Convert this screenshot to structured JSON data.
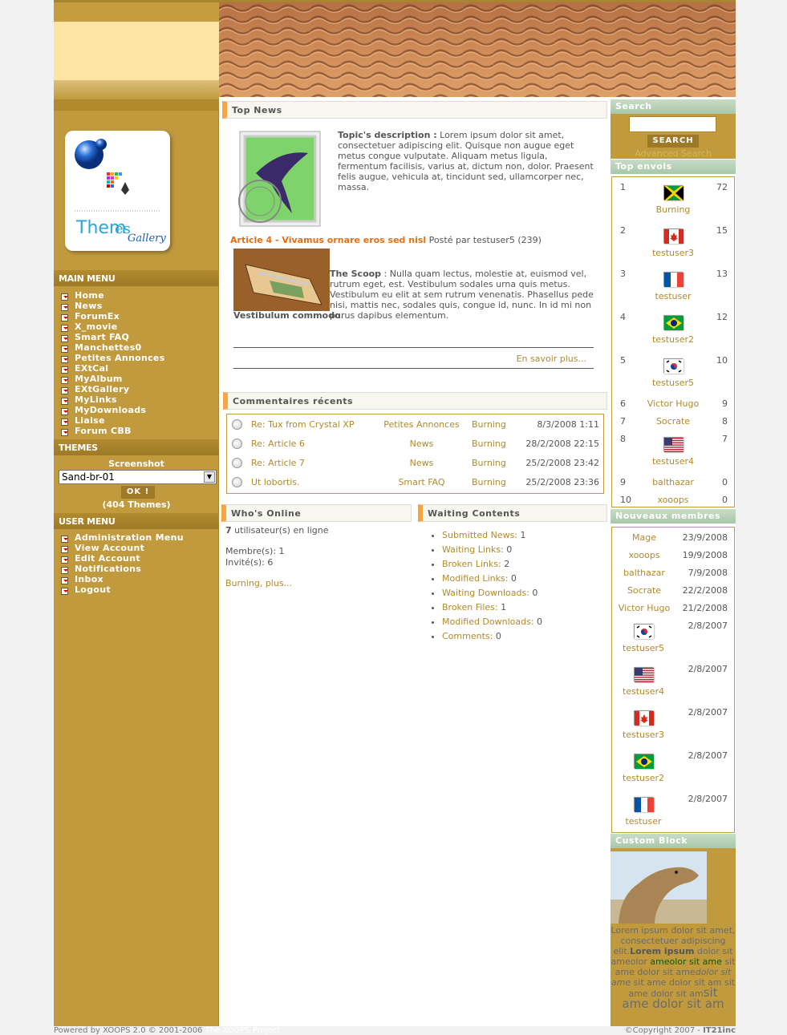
{
  "main_menu": {
    "title": "Main Menu",
    "items": [
      "Home",
      "News",
      "ForumEx",
      "X_movie",
      "Smart FAQ",
      "Manchettes0",
      "Petites Annonces",
      "EXtCal",
      "MyAlbum",
      "EXtGallery",
      "MyLinks",
      "MyDownloads",
      "Liaise",
      "Forum CBB"
    ]
  },
  "themes": {
    "title": "Themes",
    "screenshot_label": "Screenshot",
    "selected": "Sand-br-01",
    "ok_label": "OK !",
    "count": "(404 Themes)"
  },
  "user_menu": {
    "title": "User Menu",
    "items": [
      "Administration Menu",
      "View Account",
      "Edit Account",
      "Notifications",
      "Inbox",
      "Logout"
    ]
  },
  "logo_text": "Themes Gallery",
  "top_news": {
    "title": "Top News",
    "desc_label": "Topic's description :",
    "desc_text": " Lorem ipsum dolor sit amet, consectetuer adipiscing elit. Quisque non augue eget metus congue vulputate. Aliquam metus ligula, fermentum facilisis, varius at, dictum non, dolor. Praesent felis augue, vehicula at, tincidunt sed, ullamcorper nec, massa.",
    "article_title": "Article 4 - Vivamus ornare eros sed nisl",
    "posted_by": " Posté par testuser5 (239)",
    "scoop_label": "The Scoop",
    "scoop_text": " : Nulla quam lectus, molestie at, euismod vel, rutrum eget, est. Vestibulum sodales urna quis metus. Vestibulum eu elit at sem rutrum venenatis. Phasellus pede nisi, mattis nec, sodales quis, congue id, nunc. In id mi non purus dapibus elementum. ",
    "scoop_bold": "Vestibulum commodo",
    "scoop_end": ".",
    "more": "En savoir plus..."
  },
  "comments": {
    "title": "Commentaires récents",
    "rows": [
      {
        "subject": "Re: Tux from Crystal XP",
        "module": "Petites Annonces",
        "user": "Burning",
        "date": "8/3/2008 1:11"
      },
      {
        "subject": "Re: Article 6",
        "module": "News",
        "user": "Burning",
        "date": "28/2/2008 22:15"
      },
      {
        "subject": "Re: Article 7",
        "module": "News",
        "user": "Burning",
        "date": "25/2/2008 23:42"
      },
      {
        "subject": "Ut lobortis.",
        "module": "Smart FAQ",
        "user": "Burning",
        "date": "25/2/2008 23:36"
      }
    ]
  },
  "whos_online": {
    "title": "Who's Online",
    "count": "7",
    "count_text": " utilisateur(s) en ligne",
    "members": "Membre(s): 1",
    "guests": "Invité(s): 6",
    "link": "Burning, plus..."
  },
  "waiting": {
    "title": "Waiting Contents",
    "items": [
      {
        "label": "Submitted News:",
        "value": " 1"
      },
      {
        "label": "Waiting Links:",
        "value": " 0"
      },
      {
        "label": "Broken Links:",
        "value": " 2"
      },
      {
        "label": "Modified Links:",
        "value": " 0"
      },
      {
        "label": "Waiting Downloads:",
        "value": " 0"
      },
      {
        "label": "Broken Files:",
        "value": " 1"
      },
      {
        "label": "Modified Downloads:",
        "value": " 0"
      },
      {
        "label": "Comments:",
        "value": " 0"
      }
    ]
  },
  "search": {
    "title": "Search",
    "button": "SEARCH",
    "advanced": "Advanced Search",
    "value": ""
  },
  "top_envois": {
    "title": "Top envois",
    "rows": [
      {
        "rank": "1",
        "name": "Burning",
        "count": "72",
        "flag": "jamaica"
      },
      {
        "rank": "2",
        "name": "testuser3",
        "count": "15",
        "flag": "canada"
      },
      {
        "rank": "3",
        "name": "testuser",
        "count": "13",
        "flag": "france"
      },
      {
        "rank": "4",
        "name": "testuser2",
        "count": "12",
        "flag": "brazil"
      },
      {
        "rank": "5",
        "name": "testuser5",
        "count": "10",
        "flag": "korea"
      },
      {
        "rank": "6",
        "name": "Victor Hugo",
        "count": "9",
        "flag": ""
      },
      {
        "rank": "7",
        "name": "Socrate",
        "count": "8",
        "flag": ""
      },
      {
        "rank": "8",
        "name": "testuser4",
        "count": "7",
        "flag": "usa"
      },
      {
        "rank": "9",
        "name": "balthazar",
        "count": "0",
        "flag": ""
      },
      {
        "rank": "10",
        "name": "xooops",
        "count": "0",
        "flag": ""
      }
    ]
  },
  "new_members": {
    "title": "Nouveaux membres",
    "rows": [
      {
        "name": "Mage",
        "date": "23/9/2008",
        "flag": ""
      },
      {
        "name": "xooops",
        "date": "19/9/2008",
        "flag": ""
      },
      {
        "name": "balthazar",
        "date": "7/9/2008",
        "flag": ""
      },
      {
        "name": "Socrate",
        "date": "22/2/2008",
        "flag": ""
      },
      {
        "name": "Victor Hugo",
        "date": "21/2/2008",
        "flag": ""
      },
      {
        "name": "testuser5",
        "date": "2/8/2007",
        "flag": "korea"
      },
      {
        "name": "testuser4",
        "date": "2/8/2007",
        "flag": "usa"
      },
      {
        "name": "testuser3",
        "date": "2/8/2007",
        "flag": "canada"
      },
      {
        "name": "testuser2",
        "date": "2/8/2007",
        "flag": "brazil"
      },
      {
        "name": "testuser",
        "date": "2/8/2007",
        "flag": "france"
      }
    ]
  },
  "custom_block": {
    "title": "Custom Block",
    "t1": "Lorem ipsum dolor sit amet, consectetuer adipiscing elit.",
    "t2": "Lorem ipsum",
    "t3": " dolor sit ameolor ",
    "t4": "ameolor sit ame",
    "t5": " sit ame dolor sit ame",
    "t6": "dolor sit ame",
    "t7": " sit ame dolor sit am sit ame dolor sit am",
    "t8": "sit",
    "t9": "ame dolor sit am"
  },
  "footer": {
    "left": "Powered by XOOPS 2.0 © 2001-2006 ",
    "left_link": "The XOOPS Project",
    "right": "©Copyright 2007 - ",
    "right_bold": "IT21inc"
  }
}
